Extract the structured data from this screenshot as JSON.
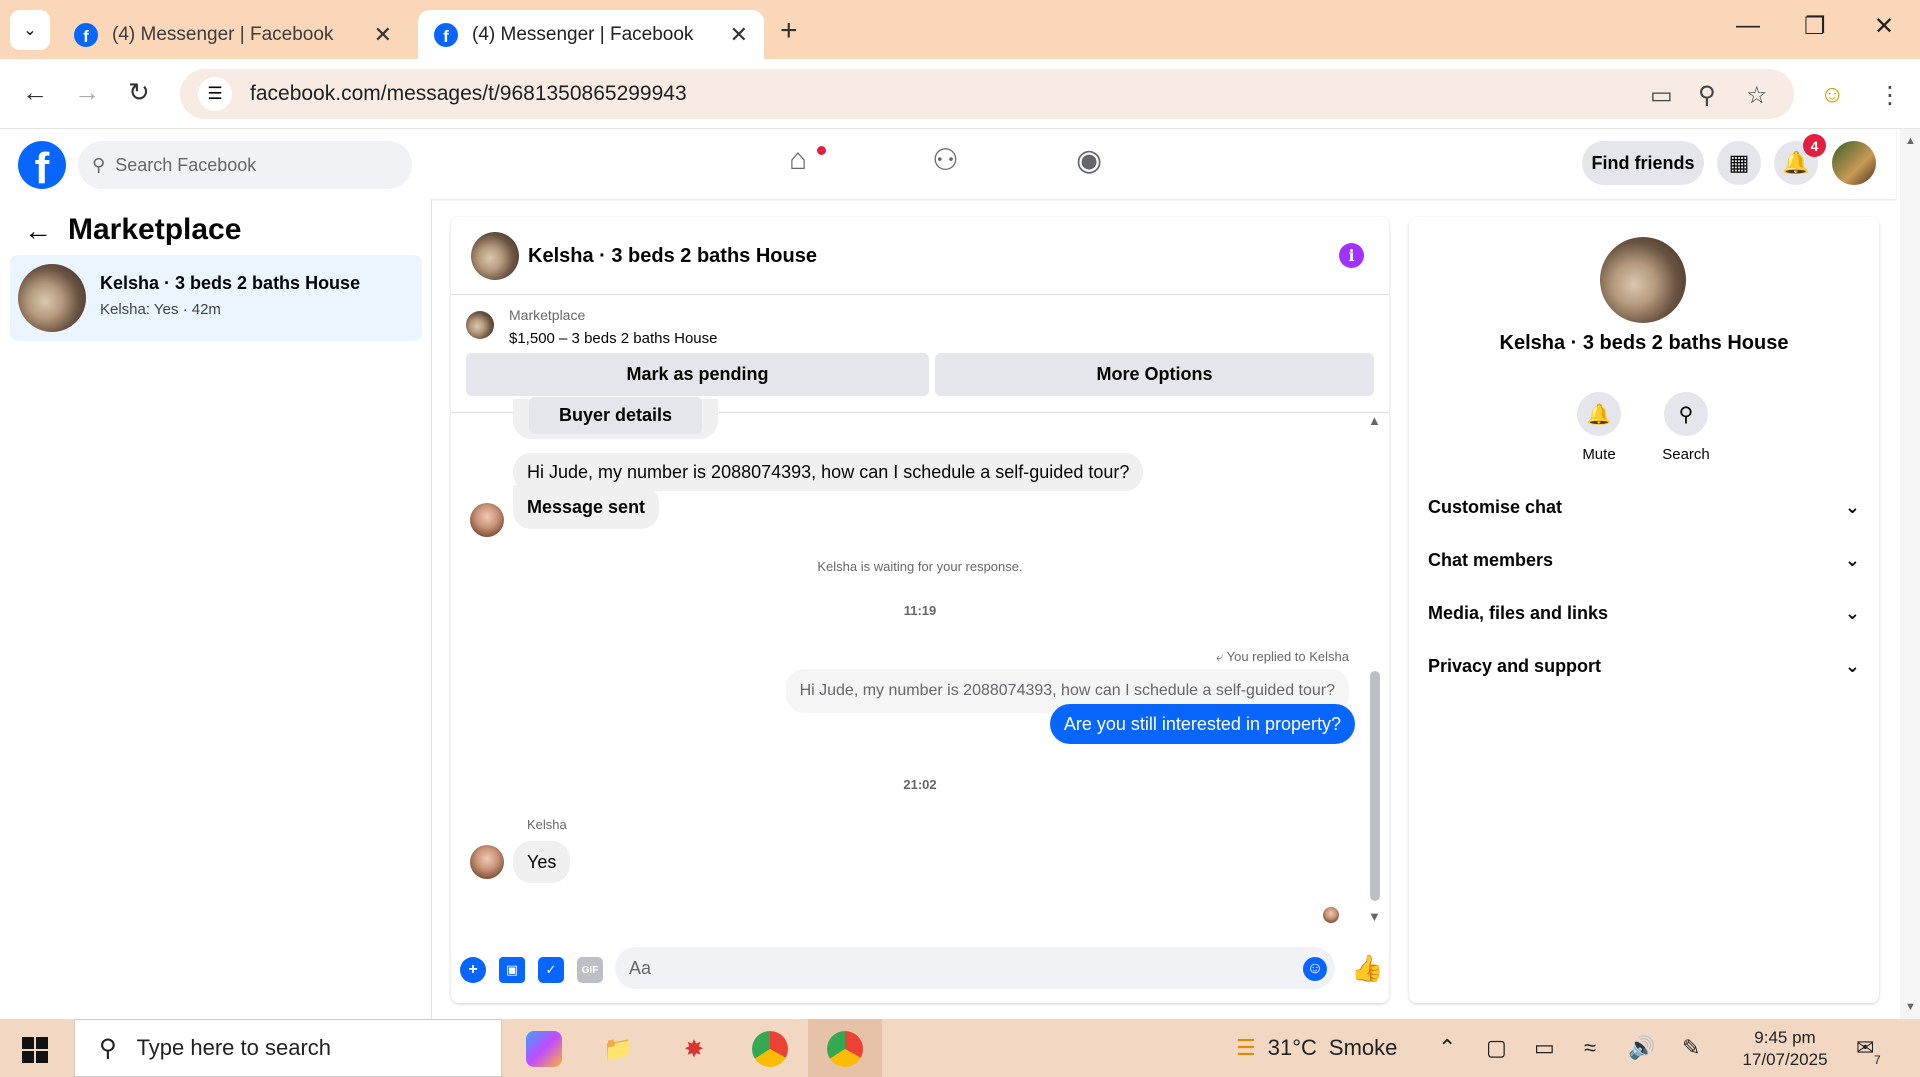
{
  "browser": {
    "tabs": [
      {
        "title": "(4) Messenger | Facebook",
        "active": false
      },
      {
        "title": "(4) Messenger | Facebook",
        "active": true
      }
    ],
    "url": "facebook.com/messages/t/9681350865299943"
  },
  "fb": {
    "search_placeholder": "Search Facebook",
    "find_friends": "Find friends",
    "notification_count": "4"
  },
  "left": {
    "title": "Marketplace",
    "thread": {
      "name": "Kelsha · 3 beds 2 baths House",
      "preview": "Kelsha: Yes · 42m"
    }
  },
  "chat": {
    "title": "Kelsha · 3 beds 2 baths House",
    "listing_label": "Marketplace",
    "listing_price": "$1,500 – 3 beds 2 baths House",
    "btn_pending": "Mark as pending",
    "btn_more": "More Options",
    "buyer_details": "Buyer details",
    "msg1": "Hi Jude, my number is 2088074393, how can I schedule a self-guided tour?",
    "msg2": "Message sent",
    "waiting": "Kelsha is waiting for your response.",
    "time1": "11:19",
    "replied_to": "You replied to Kelsha",
    "quoted": "Hi Jude, my number is 2088074393, how can I schedule a self-guided tour?",
    "outgoing": "Are you still interested in property?",
    "time2": "21:02",
    "sender": "Kelsha",
    "reply": "Yes",
    "composer_placeholder": "Aa"
  },
  "right": {
    "name": "Kelsha · 3 beds 2 baths House",
    "mute": "Mute",
    "search": "Search",
    "sections": [
      "Customise chat",
      "Chat members",
      "Media, files and links",
      "Privacy and support"
    ]
  },
  "taskbar": {
    "search_placeholder": "Type here to search",
    "weather_temp": "31°C",
    "weather_desc": "Smoke",
    "time": "9:45 pm",
    "date": "17/07/2025",
    "notif_count": "7"
  },
  "colors": {
    "fb_blue": "#0866ff",
    "accent_purple": "#a033ff",
    "tabstrip": "#fbd7ba"
  }
}
